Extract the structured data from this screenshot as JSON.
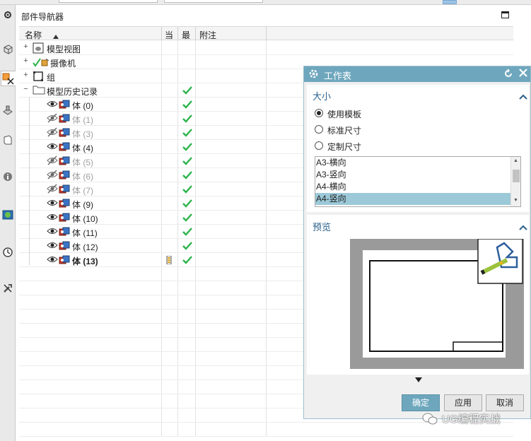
{
  "navigator": {
    "title": "部件导航器",
    "columns": {
      "name": "名称",
      "current": "当",
      "latest": "最",
      "notes": "附注"
    },
    "groups": [
      {
        "label": "模型视图",
        "icon": "model-views-icon"
      },
      {
        "label": "摄像机",
        "icon": "camera-icon"
      },
      {
        "label": "组",
        "icon": "group-icon"
      },
      {
        "label": "模型历史记录",
        "icon": "folder-icon"
      }
    ],
    "bodies": [
      {
        "label": "体 (0)",
        "visible": true
      },
      {
        "label": "体 (1)",
        "visible": false
      },
      {
        "label": "体 (3)",
        "visible": false
      },
      {
        "label": "体 (4)",
        "visible": true
      },
      {
        "label": "体 (5)",
        "visible": false
      },
      {
        "label": "体 (6)",
        "visible": false
      },
      {
        "label": "体 (7)",
        "visible": false
      },
      {
        "label": "体 (9)",
        "visible": true
      },
      {
        "label": "体 (10)",
        "visible": true
      },
      {
        "label": "体 (11)",
        "visible": true
      },
      {
        "label": "体 (12)",
        "visible": true
      },
      {
        "label": "体 (13)",
        "visible": true,
        "current": true
      }
    ]
  },
  "dialog": {
    "title": "工作表",
    "size_section": "大小",
    "options": [
      "使用模板",
      "标准尺寸",
      "定制尺寸"
    ],
    "selected_option": "使用模板",
    "templates": [
      "A3-横向",
      "A3-竖向",
      "A4-横向",
      "A4-竖向"
    ],
    "selected_template": "A4-竖向",
    "preview_section": "预览",
    "buttons": {
      "ok": "确定",
      "apply": "应用",
      "cancel": "取消"
    }
  },
  "watermark": "UG编程实战",
  "colors": {
    "accent": "#6ea7bd",
    "check": "#2bb34a",
    "selection": "#9cc9d8"
  }
}
